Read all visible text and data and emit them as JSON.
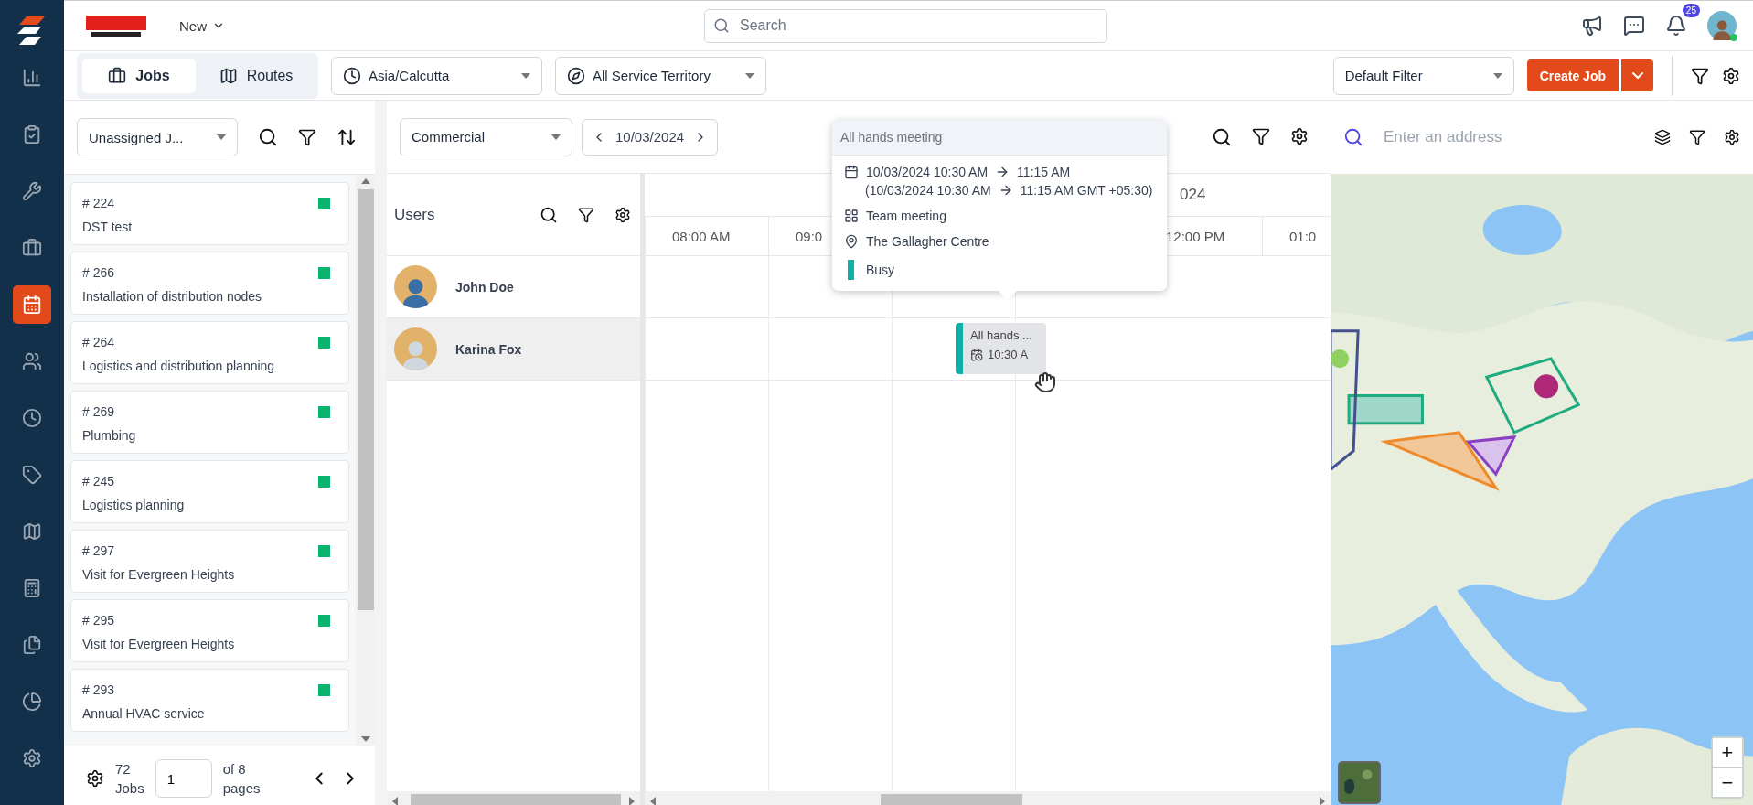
{
  "sidebar": {
    "items": [
      {
        "selected": false
      },
      {
        "selected": false
      },
      {
        "selected": false
      },
      {
        "selected": false
      },
      {
        "selected": true
      },
      {
        "selected": false
      },
      {
        "selected": false
      },
      {
        "selected": false
      },
      {
        "selected": false
      },
      {
        "selected": false
      },
      {
        "selected": false
      },
      {
        "selected": false
      },
      {
        "selected": false
      }
    ]
  },
  "header": {
    "new_menu": "New",
    "search": {
      "placeholder": "Search"
    },
    "notifications": "25"
  },
  "toolbar": {
    "tabs": [
      {
        "label": "Jobs",
        "selected": true
      },
      {
        "label": "Routes",
        "selected": false
      }
    ],
    "timezone": "Asia/Calcutta",
    "territory": "All Service Territory",
    "filter": "Default Filter",
    "create": "Create Job"
  },
  "jobs": {
    "dropdown": "Unassigned J...",
    "items": [
      {
        "number": "# 224",
        "title": "DST test"
      },
      {
        "number": "# 266",
        "title": "Installation of distribution nodes"
      },
      {
        "number": "# 264",
        "title": "Logistics and distribution planning"
      },
      {
        "number": "# 269",
        "title": "Plumbing"
      },
      {
        "number": "# 245",
        "title": "Logistics planning"
      },
      {
        "number": "# 297",
        "title": "Visit for Evergreen Heights"
      },
      {
        "number": "# 295",
        "title": "Visit for Evergreen Heights"
      },
      {
        "number": "# 293",
        "title": "Annual HVAC service"
      }
    ],
    "footer": {
      "count": "72",
      "unit": "Jobs",
      "page": "1",
      "of": "of 8",
      "pages": "pages"
    }
  },
  "schedule": {
    "category": "Commercial",
    "date": "10/03/2024",
    "users_title": "Users",
    "date_header": "024",
    "hours": [
      {
        "label": "08:00 AM"
      },
      {
        "label": "09:0"
      },
      {
        "label": "12:00 PM"
      },
      {
        "label": "01:0"
      }
    ],
    "users": [
      {
        "name": "John Doe",
        "selected": false
      },
      {
        "name": "Karina Fox",
        "selected": true
      }
    ],
    "event": {
      "title": "All hands ...",
      "time": "10:30 A"
    }
  },
  "tooltip": {
    "title": "All hands meeting",
    "time": "10/03/2024 10:30 AM",
    "time_end": "11:15 AM",
    "local": "(10/03/2024 10:30 AM",
    "local_end": "11:15 AM GMT +05:30)",
    "type": "Team meeting",
    "location": "The Gallagher Centre",
    "status": "Busy"
  },
  "map": {
    "search": {
      "placeholder": "Enter an address"
    },
    "zoom_in": "+",
    "zoom_out": "−"
  }
}
